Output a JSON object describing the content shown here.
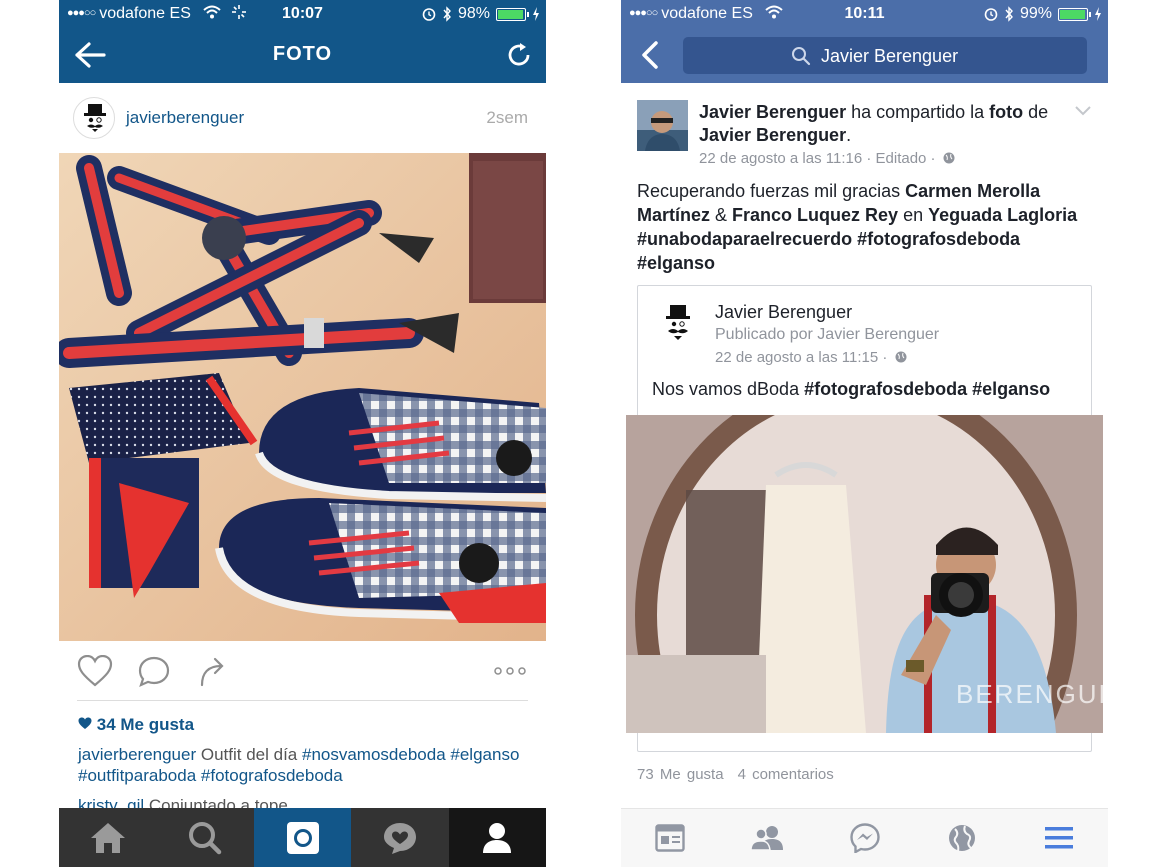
{
  "instagram": {
    "status": {
      "carrier": "vodafone ES",
      "time": "10:07",
      "battery": "98%"
    },
    "title": "FOTO",
    "post": {
      "username": "javierberenguer",
      "age": "2sem",
      "likes": "34 Me gusta",
      "caption": {
        "user": "javierberenguer",
        "text": " Outfit del día ",
        "hashtags": [
          "#nosvamosdeboda",
          "#elganso",
          "#outfitparaboda",
          "#fotografosdeboda"
        ]
      },
      "comment": {
        "user": "kristy_gil",
        "text": " Conjuntado a tope"
      }
    },
    "tabs": [
      "home",
      "search",
      "camera",
      "activity",
      "profile"
    ]
  },
  "facebook": {
    "status": {
      "carrier": "vodafone ES",
      "time": "10:11",
      "battery": "99%"
    },
    "search_text": "Javier Berenguer",
    "post": {
      "author": "Javier Berenguer",
      "shared_text": " ha compartido la ",
      "photo_word": "foto",
      "of_text": " de ",
      "owner": "Javier Berenguer",
      "owner_end": ".",
      "meta": "22 de agosto a las 11:16 · Editado ·",
      "message": {
        "intro": "Recuperando fuerzas mil gracias ",
        "tag1": "Carmen Merolla Martínez",
        "amp": " & ",
        "tag2": "Franco Luquez Rey",
        "en": " en ",
        "place": "Yeguada Lagloria",
        "hashtags": "#unabodaparaelrecuerdo #fotografosdeboda #elganso"
      },
      "inner": {
        "name": "Javier Berenguer",
        "published_by": "Publicado por Javier Berenguer",
        "meta": "22 de agosto a las 11:15 ·",
        "text": "Nos vamos dBoda ",
        "hashtags": "#fotografosdeboda #elganso"
      },
      "likes": "73 Me gusta",
      "comments": "4 comentarios"
    },
    "tabs": [
      "news-feed",
      "friends",
      "messenger",
      "notifications",
      "menu"
    ]
  }
}
